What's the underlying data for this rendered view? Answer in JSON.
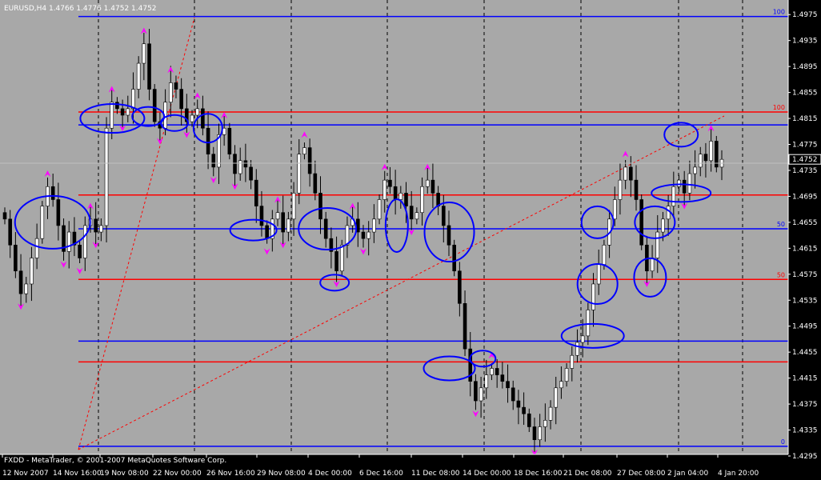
{
  "header": {
    "title": "EURUSD,H4  1.4766 1.4776 1.4752 1.4752"
  },
  "footer": {
    "credit": "FXDD - MetaTrader, © 2001-2007 MetaQuotes Software Corp."
  },
  "colors": {
    "background": "#a8a8a8",
    "blue_level": "#0000ff",
    "red_level": "#ff0000",
    "fractal": "#ff00ff",
    "ellipse": "#0000ff",
    "candle_up": "#ffffff",
    "candle_down": "#000000",
    "wick": "#000000",
    "grid": "#000000",
    "current_price_box": "#000000"
  },
  "chart_data": {
    "type": "candlestick",
    "symbol": "EURUSD",
    "timeframe": "H4",
    "ylim": [
      1.4295,
      1.4995
    ],
    "y_ticks": [
      "1.4975",
      "1.4935",
      "1.4895",
      "1.4855",
      "1.4815",
      "1.4775",
      "1.4735",
      "1.4695",
      "1.4655",
      "1.4615",
      "1.4575",
      "1.4535",
      "1.4495",
      "1.4455",
      "1.4415",
      "1.4375",
      "1.4335",
      "1.4295"
    ],
    "x_ticks": [
      "12 Nov 2007",
      "14 Nov 16:00",
      "19 Nov 08:00",
      "22 Nov 00:00",
      "26 Nov 16:00",
      "29 Nov 08:00",
      "4 Dec 00:00",
      "6 Dec 16:00",
      "11 Dec 08:00",
      "14 Dec 00:00",
      "18 Dec 16:00",
      "21 Dec 08:00",
      "27 Dec 08:00",
      "2 Jan 04:00",
      "4 Jan 20:00"
    ],
    "current_price": "1.4752",
    "blue_levels": [
      {
        "label": "100",
        "price": 1.4972
      },
      {
        "label": "",
        "price": 1.4805
      },
      {
        "label": "50",
        "price": 1.4645
      },
      {
        "label": "",
        "price": 1.4472
      },
      {
        "label": "0",
        "price": 1.431
      }
    ],
    "red_levels": [
      {
        "label": "100",
        "price": 1.4825
      },
      {
        "label": "",
        "price": 1.4697
      },
      {
        "label": "50",
        "price": 1.4567
      },
      {
        "label": "",
        "price": 1.444
      }
    ],
    "closes": [
      1.466,
      1.462,
      1.458,
      1.4545,
      1.456,
      1.46,
      1.463,
      1.468,
      1.471,
      1.469,
      1.465,
      1.461,
      1.464,
      1.462,
      1.46,
      1.465,
      1.466,
      1.464,
      1.465,
      1.48,
      1.484,
      1.483,
      1.482,
      1.483,
      1.486,
      1.49,
      1.493,
      1.486,
      1.481,
      1.48,
      1.484,
      1.487,
      1.486,
      1.483,
      1.481,
      1.482,
      1.483,
      1.48,
      1.476,
      1.474,
      1.479,
      1.48,
      1.476,
      1.473,
      1.475,
      1.474,
      1.472,
      1.468,
      1.465,
      1.463,
      1.466,
      1.467,
      1.464,
      1.466,
      1.47,
      1.476,
      1.477,
      1.473,
      1.47,
      1.466,
      1.463,
      1.461,
      1.458,
      1.462,
      1.465,
      1.466,
      1.464,
      1.463,
      1.464,
      1.466,
      1.469,
      1.472,
      1.471,
      1.469,
      1.47,
      1.468,
      1.466,
      1.467,
      1.471,
      1.472,
      1.47,
      1.468,
      1.465,
      1.462,
      1.458,
      1.453,
      1.446,
      1.441,
      1.438,
      1.44,
      1.442,
      1.443,
      1.442,
      1.441,
      1.44,
      1.438,
      1.437,
      1.436,
      1.434,
      1.432,
      1.434,
      1.435,
      1.437,
      1.44,
      1.441,
      1.443,
      1.445,
      1.447,
      1.448,
      1.452,
      1.456,
      1.459,
      1.462,
      1.466,
      1.469,
      1.472,
      1.474,
      1.472,
      1.469,
      1.462,
      1.458,
      1.46,
      1.464,
      1.466,
      1.468,
      1.471,
      1.472,
      1.47,
      1.473,
      1.474,
      1.476,
      1.475,
      1.478,
      1.474,
      1.4752
    ],
    "ellipses": [
      {
        "cx": 1.4655,
        "day": 20,
        "rx": 47,
        "ry": 33
      },
      {
        "cx": 1.4815,
        "day": 45,
        "rx": 40,
        "ry": 18
      },
      {
        "cx": 1.4818,
        "day": 60,
        "rx": 20,
        "ry": 12
      },
      {
        "cx": 1.4808,
        "day": 71,
        "rx": 17,
        "ry": 10
      },
      {
        "cx": 1.48,
        "day": 85,
        "rx": 18,
        "ry": 18
      },
      {
        "cx": 1.4643,
        "day": 104,
        "rx": 29,
        "ry": 13
      },
      {
        "cx": 1.4645,
        "day": 135,
        "rx": 36,
        "ry": 26
      },
      {
        "cx": 1.4562,
        "day": 138,
        "rx": 18,
        "ry": 10
      },
      {
        "cx": 1.465,
        "day": 164,
        "rx": 14,
        "ry": 33
      },
      {
        "cx": 1.464,
        "day": 186,
        "rx": 31,
        "ry": 37
      },
      {
        "cx": 1.443,
        "day": 186,
        "rx": 32,
        "ry": 15
      },
      {
        "cx": 1.4445,
        "day": 200,
        "rx": 16,
        "ry": 10
      },
      {
        "cx": 1.448,
        "day": 246,
        "rx": 39,
        "ry": 15
      },
      {
        "cx": 1.456,
        "day": 248,
        "rx": 25,
        "ry": 25
      },
      {
        "cx": 1.4655,
        "day": 248,
        "rx": 20,
        "ry": 20
      },
      {
        "cx": 1.457,
        "day": 270,
        "rx": 20,
        "ry": 24
      },
      {
        "cx": 1.4655,
        "day": 272,
        "rx": 25,
        "ry": 20
      },
      {
        "cx": 1.47,
        "day": 283,
        "rx": 37,
        "ry": 11
      },
      {
        "cx": 1.479,
        "day": 283,
        "rx": 21,
        "ry": 15
      }
    ]
  }
}
